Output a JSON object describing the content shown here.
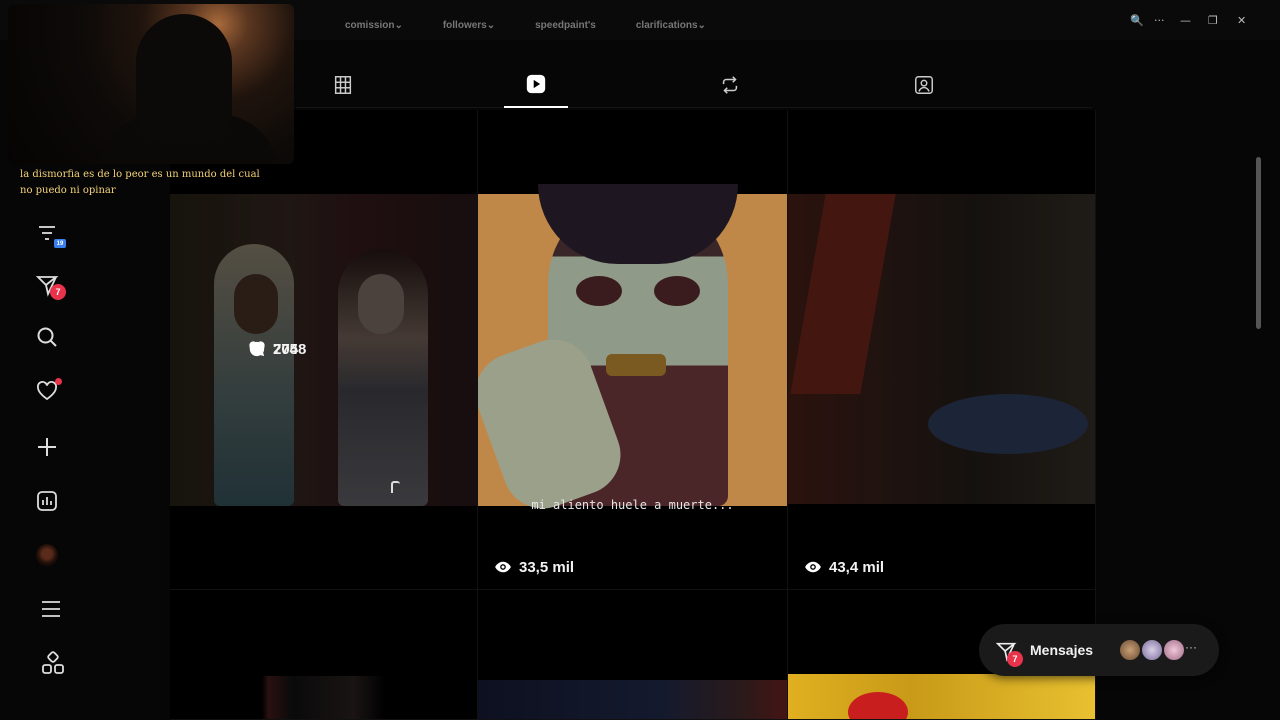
{
  "window": {
    "controls": [
      "🔍",
      "···",
      "—",
      "❐",
      "✕"
    ]
  },
  "overlay": {
    "caption": "la dismorfia es de lo peor es un mundo del cual no puedo ni opinar"
  },
  "profile_links": [
    "comission⌄",
    "followers⌄",
    "speedpaint's",
    "clarifications⌄"
  ],
  "tabs": [
    {
      "icon": "grid-icon",
      "active": false
    },
    {
      "icon": "reels-icon",
      "active": true
    },
    {
      "icon": "repost-icon",
      "active": false
    },
    {
      "icon": "tagged-icon",
      "active": false
    }
  ],
  "sidebar": {
    "items": [
      {
        "icon": "filter-icon",
        "badge": "19"
      },
      {
        "icon": "messages-icon",
        "badge": "7"
      },
      {
        "icon": "search-icon"
      },
      {
        "icon": "heart-icon",
        "dot": true
      },
      {
        "icon": "create-icon"
      },
      {
        "icon": "stats-icon"
      },
      {
        "icon": "profile-avatar"
      },
      {
        "icon": "menu-icon"
      },
      {
        "icon": "more-apps-icon"
      }
    ]
  },
  "posts": [
    {
      "likes": "7758",
      "comments": "204",
      "hovered": true
    },
    {
      "subtitle": "mi aliento huele a muerte...",
      "views": "33,5 mil"
    },
    {
      "views": "43,4 mil"
    }
  ],
  "messages": {
    "label": "Mensajes",
    "badge": "7"
  },
  "colors": {
    "accent": "#e8334a",
    "caption": "#f4d27a",
    "background": "#060606"
  }
}
